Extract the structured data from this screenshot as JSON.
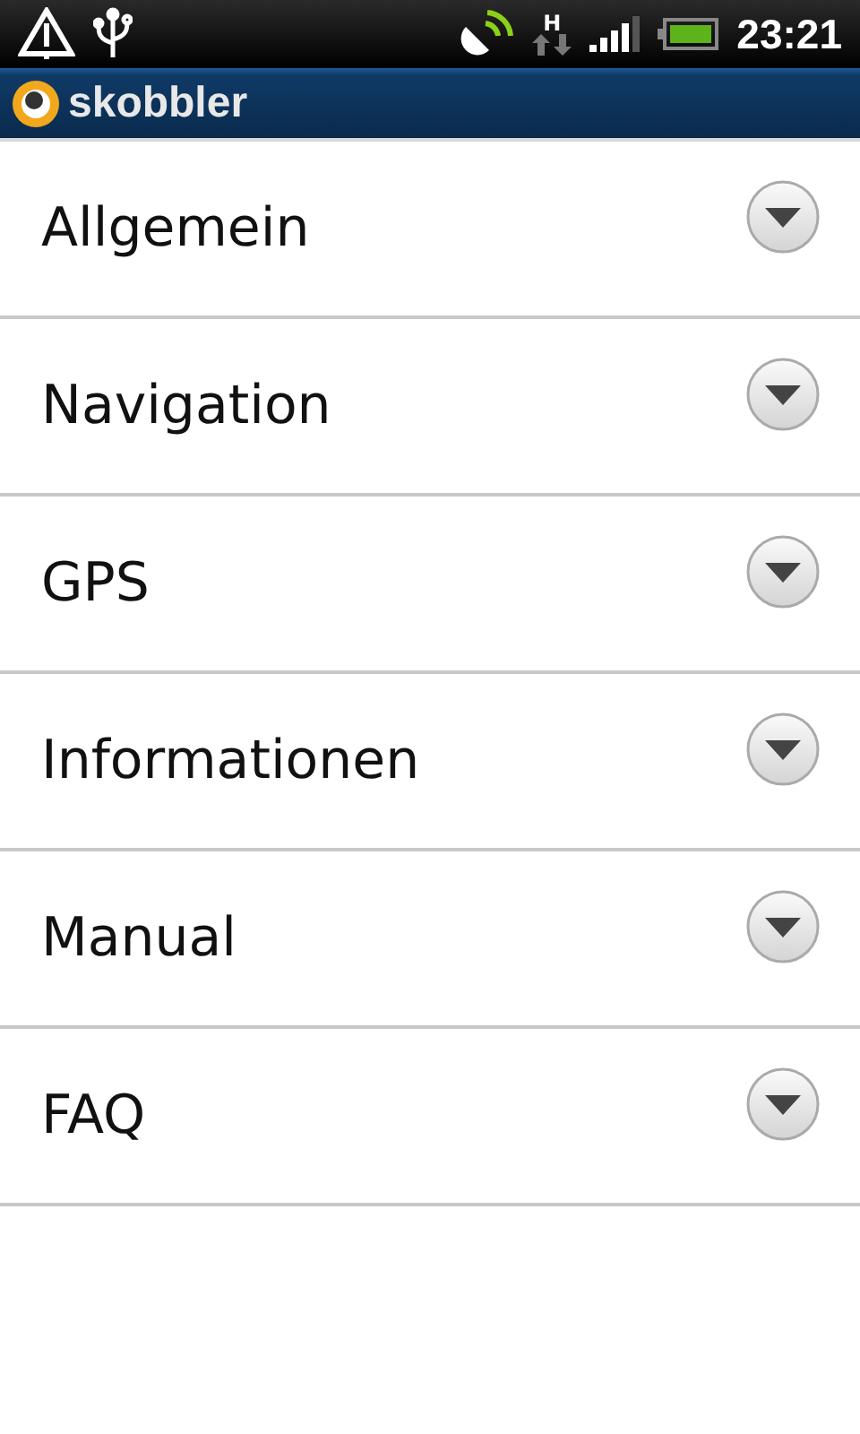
{
  "status_bar": {
    "network": "H",
    "time": "23:21"
  },
  "app_bar": {
    "title": "skobbler"
  },
  "sections": [
    {
      "label": "Allgemein",
      "expanded": false
    },
    {
      "label": "Navigation",
      "expanded": false
    },
    {
      "label": "GPS",
      "expanded": false
    },
    {
      "label": "Informationen",
      "expanded": false
    },
    {
      "label": "Manual",
      "expanded": false
    },
    {
      "label": "FAQ",
      "expanded": false
    }
  ]
}
